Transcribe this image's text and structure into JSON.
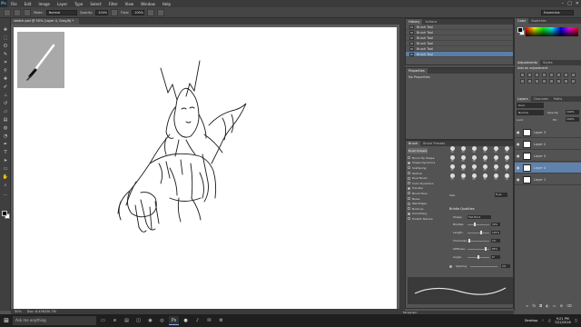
{
  "app": {
    "logo": "Ps"
  },
  "menu": [
    "File",
    "Edit",
    "Image",
    "Layer",
    "Type",
    "Select",
    "Filter",
    "View",
    "Window",
    "Help"
  ],
  "options_bar": {
    "mode_label": "Mode:",
    "mode_value": "Normal",
    "opacity_label": "Opacity:",
    "opacity_value": "100%",
    "flow_label": "Flow:",
    "flow_value": "100%",
    "workspace": "Essentials"
  },
  "document": {
    "tab_title": "sketch.psd @ 50% (Layer 4, Gray/8) *",
    "zoom": "50%",
    "doc_info": "Doc: 8.43M/30.7M"
  },
  "history": {
    "tabs": [
      "History",
      "Actions"
    ],
    "items": [
      "Brush Tool",
      "Brush Tool",
      "Brush Tool",
      "Brush Tool",
      "Brush Tool",
      "Brush Tool"
    ],
    "active_index": 5
  },
  "properties": {
    "tab": "Properties",
    "message": "No Properties"
  },
  "color_panel": {
    "tabs": [
      "Color",
      "Swatches"
    ],
    "fg": "#000000",
    "bg": "#ffffff"
  },
  "adjustments": {
    "tabs": [
      "Adjustments",
      "Styles"
    ],
    "title": "Add an adjustment"
  },
  "layers": {
    "tabs": [
      "Layers",
      "Channels",
      "Paths"
    ],
    "kind_label": "Kind",
    "blend_mode": "Normal",
    "opacity_label": "Opacity:",
    "opacity_value": "100%",
    "lock_label": "Lock:",
    "fill_label": "Fill:",
    "fill_value": "100%",
    "items": [
      "Layer 3",
      "Layer 2",
      "Layer 5",
      "Layer 4",
      "Layer 1"
    ],
    "active_index": 3
  },
  "brush_panel": {
    "tabs": [
      "Brush",
      "Brush Presets"
    ],
    "presets_button": "Brush Presets",
    "options": [
      {
        "label": "Brush Tip Shape",
        "checked": false
      },
      {
        "label": "Shape Dynamics",
        "checked": true
      },
      {
        "label": "Scattering",
        "checked": false
      },
      {
        "label": "Texture",
        "checked": false
      },
      {
        "label": "Dual Brush",
        "checked": false
      },
      {
        "label": "Color Dynamics",
        "checked": false
      },
      {
        "label": "Transfer",
        "checked": true
      },
      {
        "label": "Brush Pose",
        "checked": false
      },
      {
        "label": "Noise",
        "checked": false
      },
      {
        "label": "Wet Edges",
        "checked": false
      },
      {
        "label": "Build-up",
        "checked": false
      },
      {
        "label": "Smoothing",
        "checked": true
      },
      {
        "label": "Protect Texture",
        "checked": false
      }
    ],
    "tips": [
      "30",
      "30",
      "30",
      "25",
      "25",
      "25",
      "36",
      "25",
      "36",
      "36",
      "36",
      "32",
      "25",
      "50",
      "25",
      "25",
      "50",
      "71",
      "25",
      "50",
      "50",
      "36",
      "30",
      "14"
    ],
    "size_label": "Size",
    "size_value": "8 px",
    "section_title": "Bristle Qualities",
    "shape_label": "Shape:",
    "shape_value": "Flat Point",
    "rows": [
      {
        "label": "Bristles:",
        "value": "30%",
        "level": 0.3
      },
      {
        "label": "Length:",
        "value": "125%",
        "level": 0.62
      },
      {
        "label": "Thickness:",
        "value": "2%",
        "level": 0.05
      },
      {
        "label": "Stiffness:",
        "value": "85%",
        "level": 0.85
      },
      {
        "label": "Angle:",
        "value": "0°",
        "level": 0.5
      }
    ],
    "spacing_label": "Spacing",
    "spacing_value": "2%"
  },
  "paragraph_tab": "Paragraph",
  "taskbar": {
    "search_placeholder": "Ask me anything",
    "desktop_label": "Desktop",
    "time": "9:21 PM",
    "date": "7/22/2016"
  }
}
